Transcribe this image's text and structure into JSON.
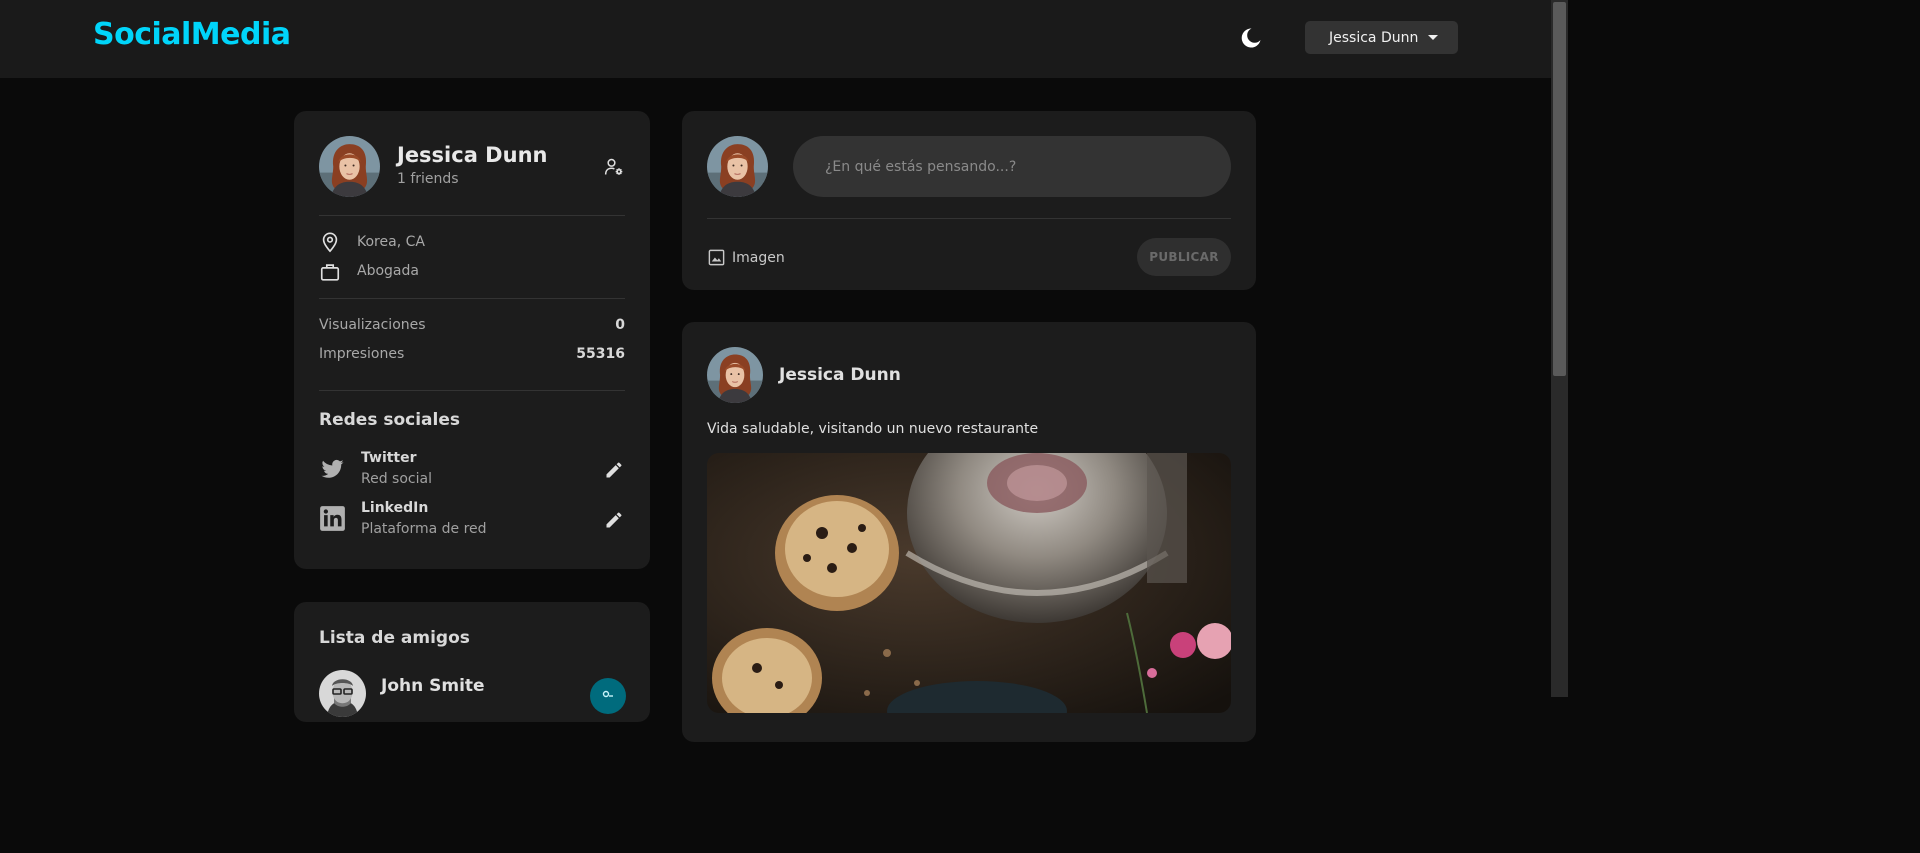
{
  "navbar": {
    "brand": "SocialMedia",
    "theme_icon": "moon-icon",
    "user_select_value": "Jessica Dunn"
  },
  "user_card": {
    "name": "Jessica Dunn",
    "friends": "1 friends",
    "location": "Korea, CA",
    "occupation": "Abogada",
    "stats": [
      {
        "label": "Visualizaciones",
        "value": "0"
      },
      {
        "label": "Impresiones",
        "value": "55316"
      }
    ],
    "social_title": "Redes sociales",
    "socials": [
      {
        "name": "Twitter",
        "desc": "Red social",
        "icon": "twitter-icon"
      },
      {
        "name": "LinkedIn",
        "desc": "Plataforma de red",
        "icon": "linkedin-icon"
      }
    ]
  },
  "friends_card": {
    "title": "Lista de amigos",
    "friends": [
      {
        "name": "John Smite"
      }
    ]
  },
  "composer": {
    "placeholder": "¿En qué estás pensando...?",
    "image_label": "Imagen",
    "publish_label": "PUBLICAR"
  },
  "post": {
    "author": "Jessica Dunn",
    "text": "Vida saludable, visitando un nuevo restaurante"
  },
  "colors": {
    "brand": "#00d5fa",
    "background": "#0a0a0a",
    "card": "#1c1c1c",
    "navbar": "#1a1a1a"
  }
}
